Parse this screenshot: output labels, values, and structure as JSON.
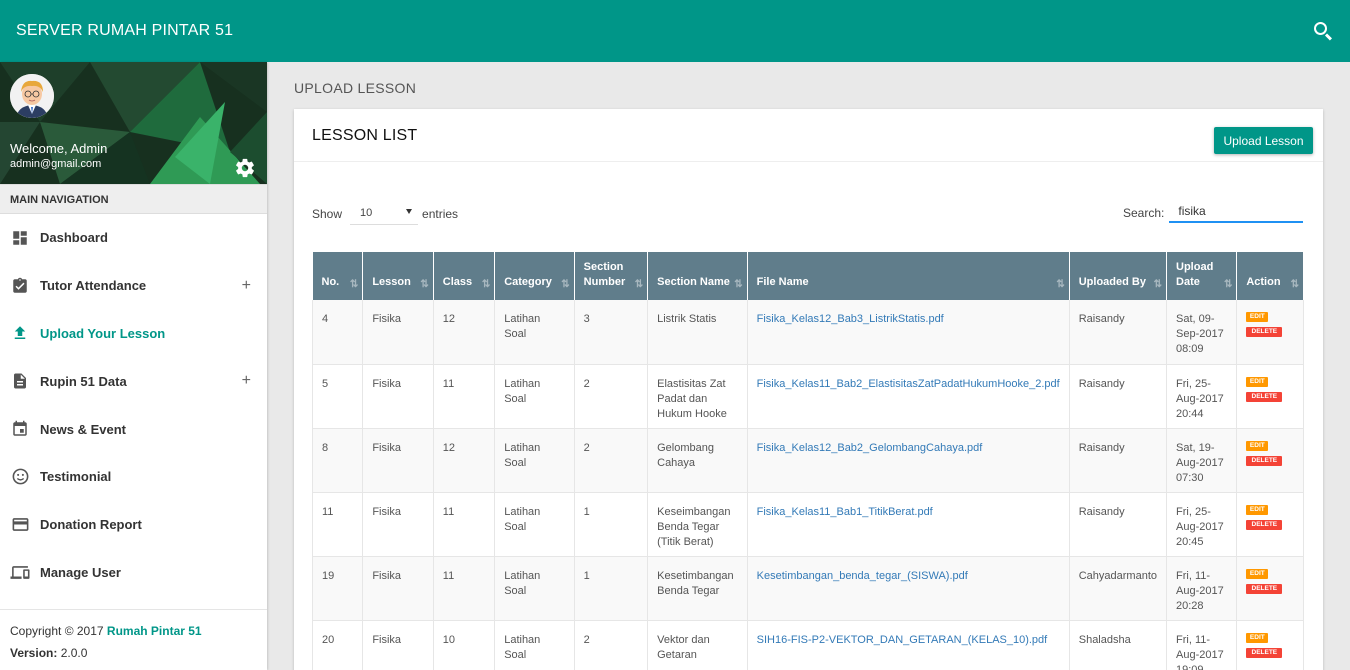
{
  "app": {
    "title": "SERVER RUMAH PINTAR 51"
  },
  "user": {
    "welcome": "Welcome, Admin",
    "email": "admin@gmail.com"
  },
  "nav": {
    "header": "MAIN NAVIGATION",
    "items": [
      {
        "label": "Dashboard",
        "icon": "dashboard-icon"
      },
      {
        "label": "Tutor Attendance",
        "icon": "assignment-check-icon",
        "expandable": "+"
      },
      {
        "label": "Upload Your Lesson",
        "icon": "upload-icon",
        "active": true
      },
      {
        "label": "Rupin 51 Data",
        "icon": "document-icon",
        "expandable": "+"
      },
      {
        "label": "News & Event",
        "icon": "calendar-icon"
      },
      {
        "label": "Testimonial",
        "icon": "smiley-icon"
      },
      {
        "label": "Donation Report",
        "icon": "credit-card-icon"
      },
      {
        "label": "Manage User",
        "icon": "laptop-icon"
      }
    ]
  },
  "legal": {
    "copyright": "Copyright © 2017 ",
    "brand": "Rumah Pintar 51",
    "version_label": "Version:",
    "version": " 2.0.0"
  },
  "page": {
    "block_header": "UPLOAD LESSON"
  },
  "card": {
    "title": "LESSON LIST",
    "upload_button": "Upload Lesson"
  },
  "table_controls": {
    "show_label": "Show",
    "entries_value": "10",
    "entries_label": "entries",
    "search_label": "Search:",
    "search_value": "fisika"
  },
  "table": {
    "columns": [
      "No.",
      "Lesson",
      "Class",
      "Category",
      "Section Number",
      "Section Name",
      "File Name",
      "Uploaded By",
      "Upload Date",
      "Action"
    ],
    "rows": [
      {
        "no": "4",
        "lesson": "Fisika",
        "class": "12",
        "category": "Latihan Soal",
        "section_number": "3",
        "section_name": "Listrik Statis",
        "file": "Fisika_Kelas12_Bab3_ListrikStatis.pdf",
        "by": "Raisandy",
        "date": "Sat, 09-Sep-2017 08:09"
      },
      {
        "no": "5",
        "lesson": "Fisika",
        "class": "11",
        "category": "Latihan Soal",
        "section_number": "2",
        "section_name": "Elastisitas Zat Padat dan Hukum Hooke",
        "file": "Fisika_Kelas11_Bab2_ElastisitasZatPadatHukumHooke_2.pdf",
        "by": "Raisandy",
        "date": "Fri, 25-Aug-2017 20:44"
      },
      {
        "no": "8",
        "lesson": "Fisika",
        "class": "12",
        "category": "Latihan Soal",
        "section_number": "2",
        "section_name": "Gelombang Cahaya",
        "file": "Fisika_Kelas12_Bab2_GelombangCahaya.pdf",
        "by": "Raisandy",
        "date": "Sat, 19-Aug-2017 07:30"
      },
      {
        "no": "11",
        "lesson": "Fisika",
        "class": "11",
        "category": "Latihan Soal",
        "section_number": "1",
        "section_name": "Keseimbangan Benda Tegar (Titik Berat)",
        "file": "Fisika_Kelas11_Bab1_TitikBerat.pdf",
        "by": "Raisandy",
        "date": "Fri, 25-Aug-2017 20:45"
      },
      {
        "no": "19",
        "lesson": "Fisika",
        "class": "11",
        "category": "Latihan Soal",
        "section_number": "1",
        "section_name": "Kesetimbangan Benda Tegar",
        "file": "Kesetimbangan_benda_tegar_(SISWA).pdf",
        "by": "Cahyadarmanto",
        "date": "Fri, 11-Aug-2017 20:28"
      },
      {
        "no": "20",
        "lesson": "Fisika",
        "class": "10",
        "category": "Latihan Soal",
        "section_number": "2",
        "section_name": "Vektor dan Getaran",
        "file": "SIH16-FIS-P2-VEKTOR_DAN_GETARAN_(KELAS_10).pdf",
        "by": "Shaladsha",
        "date": "Fri, 11-Aug-2017 19:09"
      }
    ],
    "actions": {
      "edit": "EDIT",
      "delete": "DELETE"
    }
  },
  "colors": {
    "primary": "#009688",
    "table_header": "#607d8b",
    "edit": "#ff9800",
    "delete": "#f44336",
    "link": "#337ab7"
  }
}
